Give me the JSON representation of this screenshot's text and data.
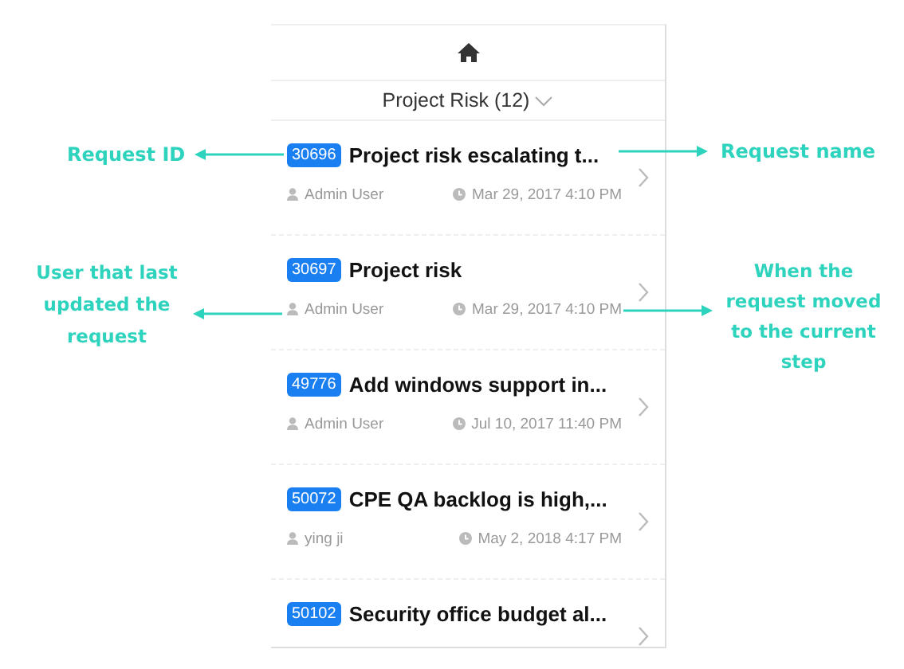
{
  "header": {
    "title": "Project Risk (12)"
  },
  "requests": [
    {
      "id": "30696",
      "name": "Project risk escalating t...",
      "user": "Admin User",
      "time": "Mar 29, 2017 4:10 PM"
    },
    {
      "id": "30697",
      "name": "Project risk",
      "user": "Admin User",
      "time": "Mar 29, 2017 4:10 PM"
    },
    {
      "id": "49776",
      "name": "Add windows support in...",
      "user": "Admin User",
      "time": "Jul 10, 2017 11:40 PM"
    },
    {
      "id": "50072",
      "name": "CPE QA backlog is high,...",
      "user": "ying ji",
      "time": "May 2, 2018 4:17 PM"
    },
    {
      "id": "50102",
      "name": "Security office budget al..."
    }
  ],
  "annotations": [
    {
      "text": "Request ID",
      "kind": "left"
    },
    {
      "text": "Request name",
      "kind": "right"
    },
    {
      "text": "User that last updated the request",
      "kind": "left"
    },
    {
      "text": "When the request moved to the current step",
      "kind": "right"
    }
  ]
}
